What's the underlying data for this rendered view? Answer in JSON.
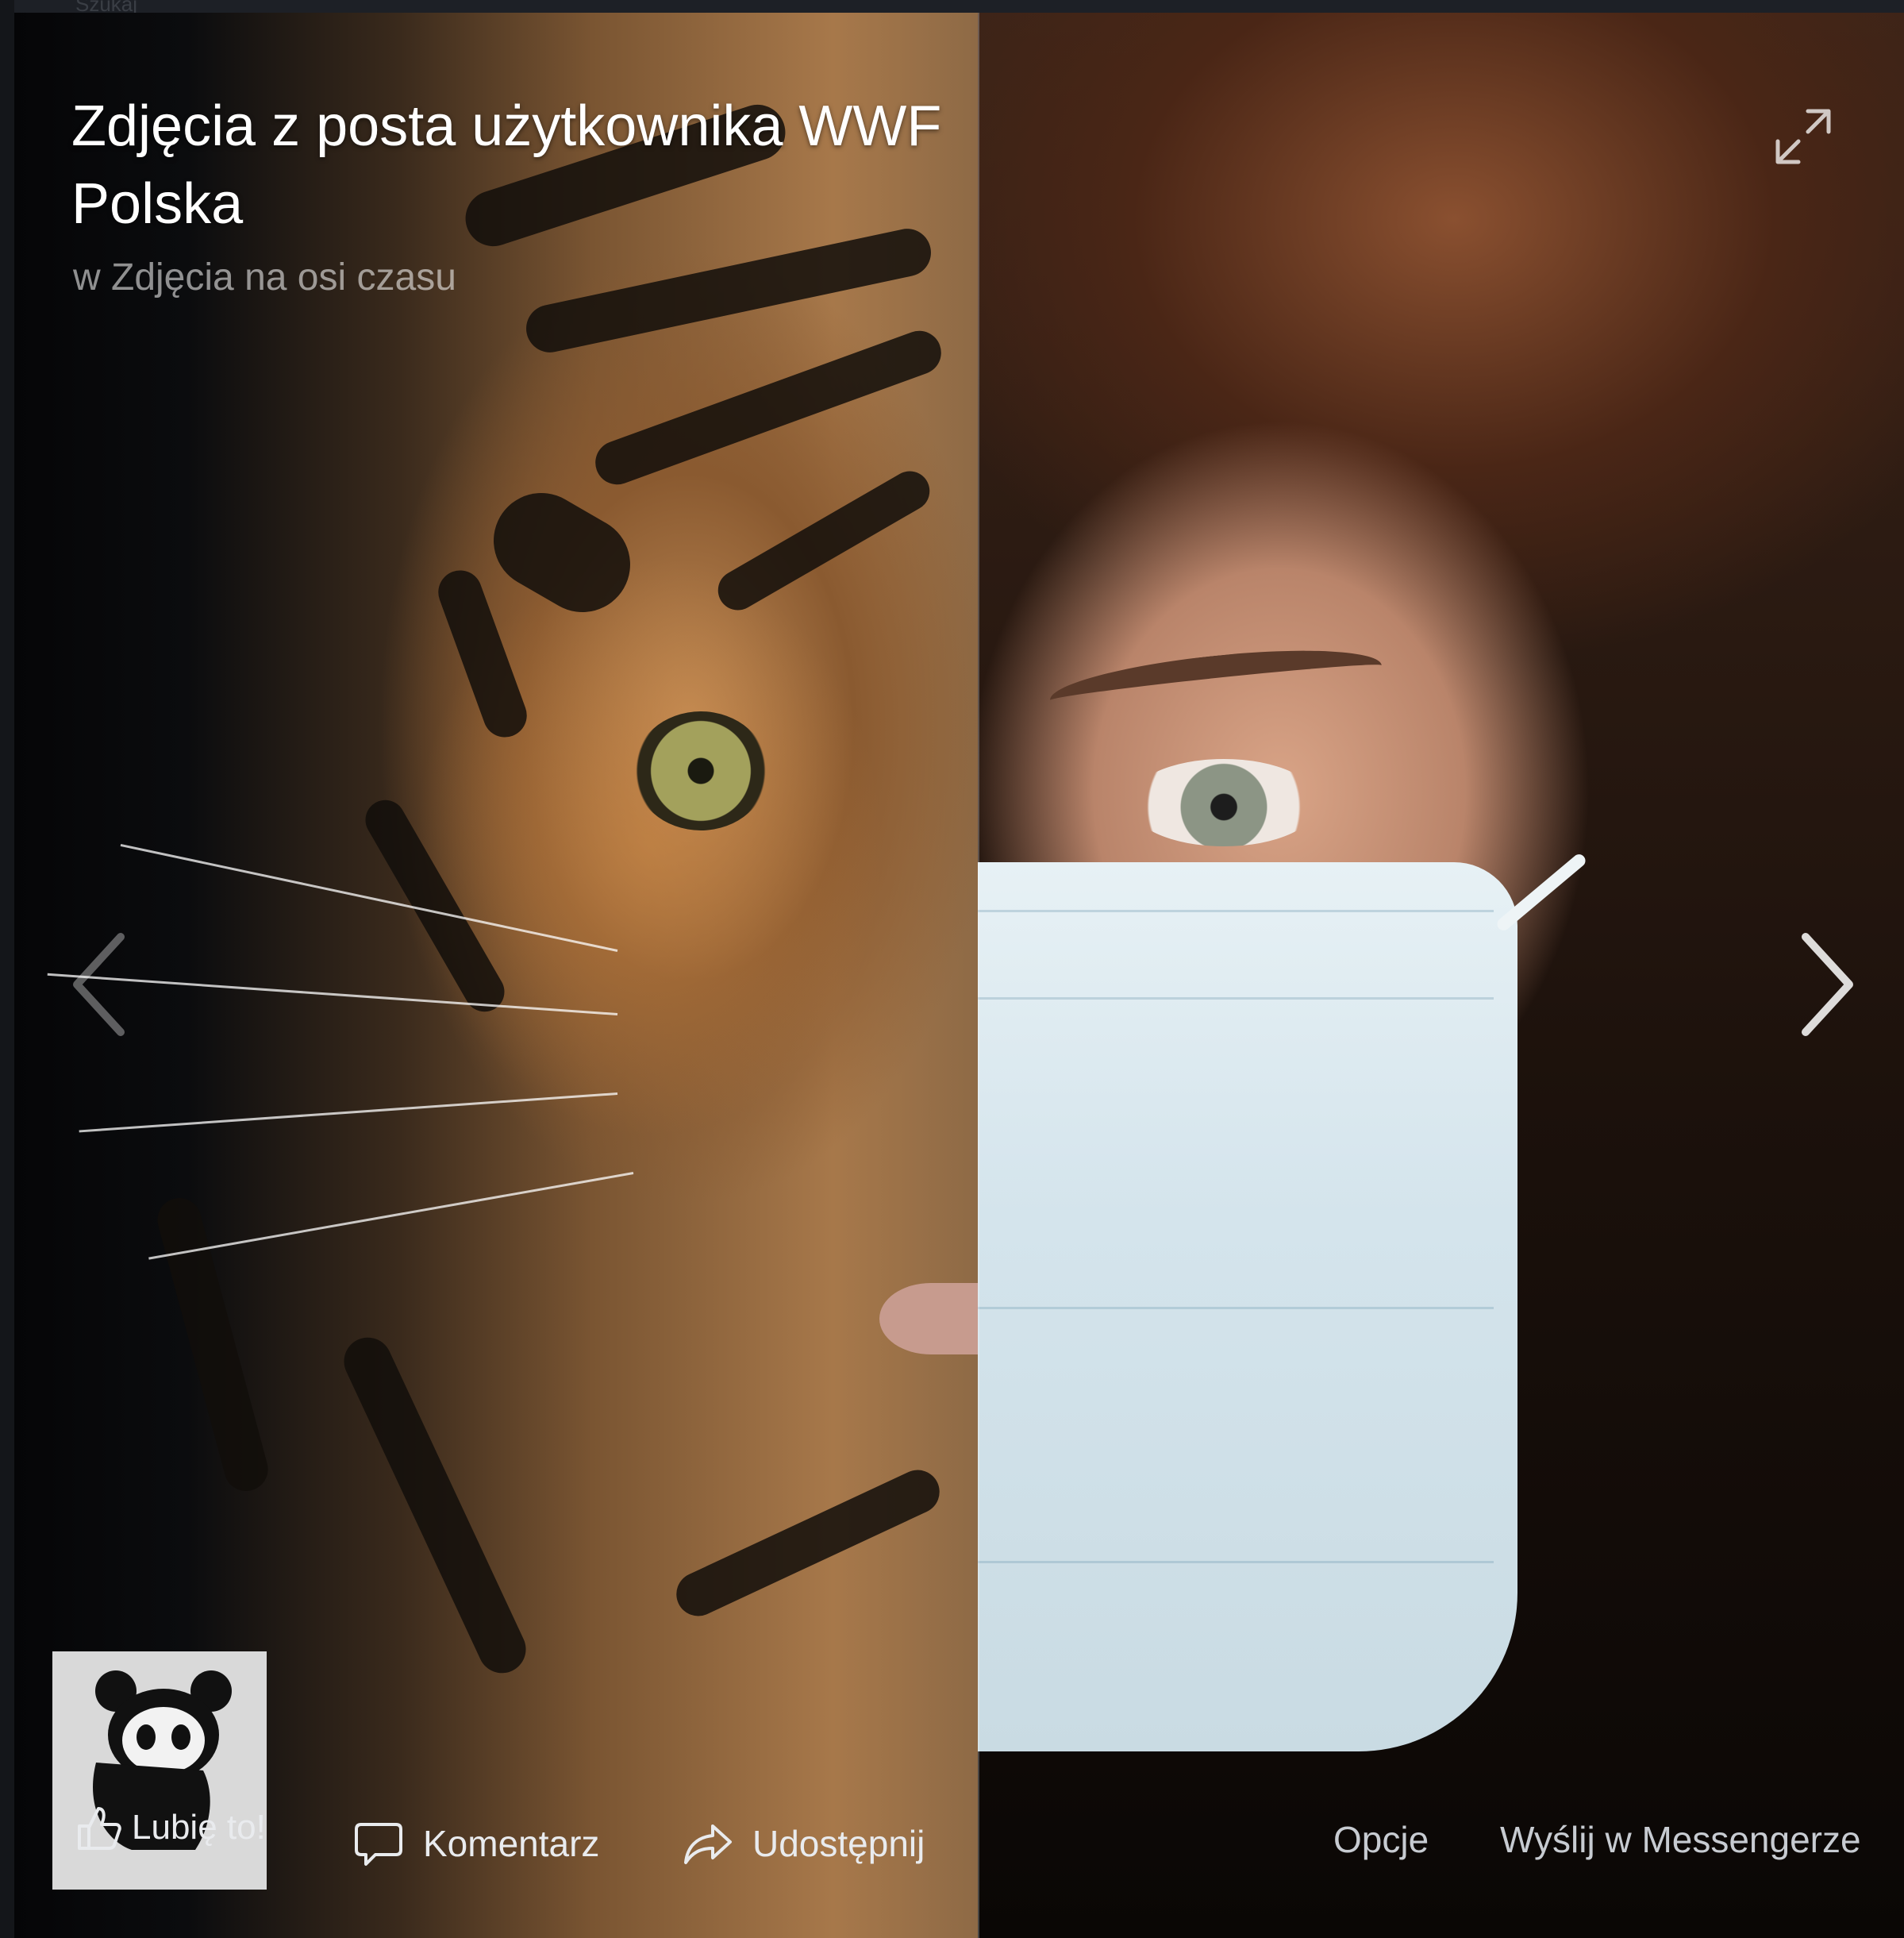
{
  "viewer": {
    "title": "Zdjęcia z posta użytkownika WWF Polska",
    "subtitle": "w Zdjęcia na osi czasu",
    "top_strip_text": "Szukaj"
  },
  "controls": {
    "expand_icon": "expand-icon",
    "prev_icon": "chevron-left-icon",
    "next_icon": "chevron-right-icon"
  },
  "logo": {
    "text": "WWF",
    "icon": "panda-logo"
  },
  "actions": {
    "like_label": "Lubię to!",
    "comment_label": "Komentarz",
    "share_label": "Udostępnij",
    "options_label": "Opcje",
    "messenger_label": "Wyślij w Messengerze"
  },
  "colors": {
    "text": "#ffffff",
    "muted": "#c7cbd1",
    "background": "#0d0f12"
  }
}
